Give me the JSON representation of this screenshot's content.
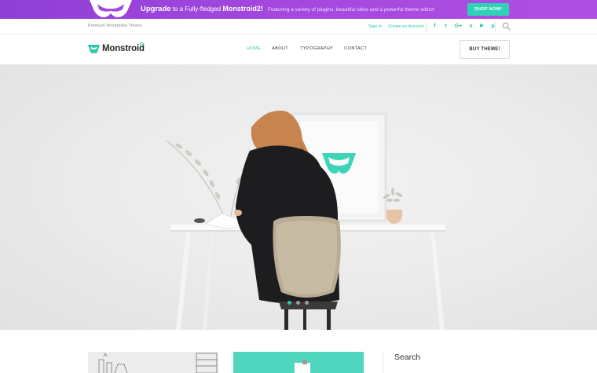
{
  "promo": {
    "highlight": "Upgrade",
    "text": " to a Fully-fledged ",
    "product": "Monstroid2!",
    "subtext": "Featuring a variety of plugins, beautiful skins and a powerful theme editor!",
    "cta": "SHOP NOW!",
    "logo_icon": "monstroid-mask-icon"
  },
  "topbar": {
    "tagline": "Premium Wordpress Theme",
    "sign_in": "Sign In",
    "create_account": "Create an Account",
    "socials": [
      "facebook-icon",
      "twitter-icon",
      "google-plus-icon",
      "vimeo-icon",
      "youtube-icon",
      "pinterest-icon"
    ],
    "social_glyphs": [
      "f",
      "t",
      "G+",
      "v",
      "▶",
      "p"
    ],
    "search_icon": "search-icon"
  },
  "header": {
    "brand": "Monstroid",
    "nav": [
      "HOME",
      "ABOUT",
      "TYPOGRAPHY",
      "CONTACT"
    ],
    "active_nav": "HOME",
    "buy_button": "BUY THEME!"
  },
  "hero": {
    "slider_dots": 3,
    "active_dot": 0
  },
  "sidebar": {
    "search_title": "Search"
  },
  "colors": {
    "accent": "#2ec7ab",
    "promo_gradient_start": "#8f3fd6",
    "promo_gradient_end": "#b04fe3"
  }
}
